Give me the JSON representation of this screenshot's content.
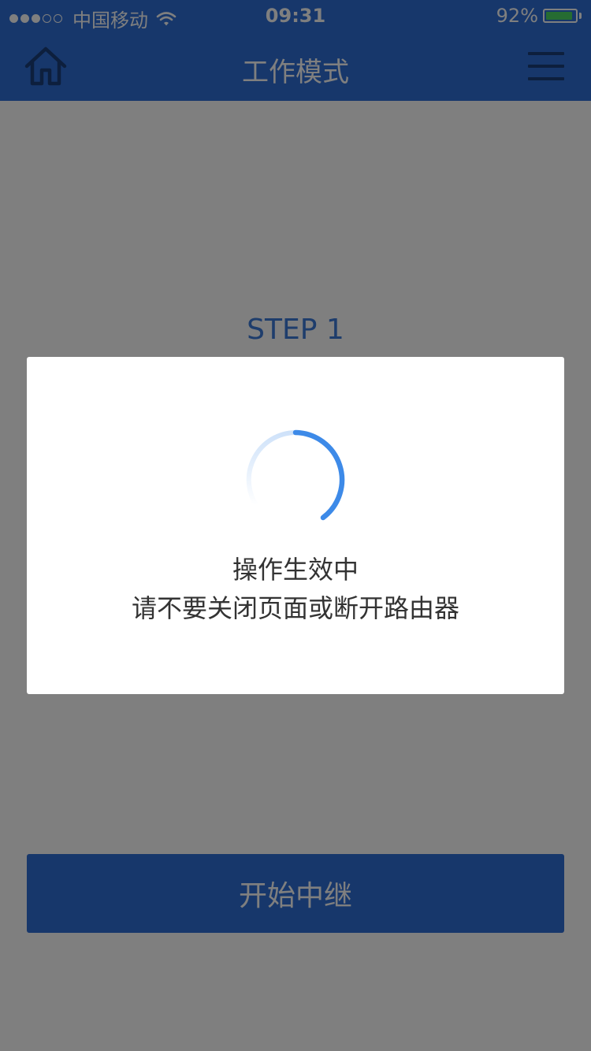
{
  "status_bar": {
    "signal_filled": 3,
    "signal_total": 5,
    "carrier": "中国移动",
    "time": "09:31",
    "battery_percent": "92%",
    "battery_level": 0.92
  },
  "navbar": {
    "title": "工作模式",
    "left_icon": "home-icon",
    "right_icon": "menu-icon"
  },
  "main": {
    "step_label": "STEP 1",
    "start_button_label": "开始中继"
  },
  "dialog": {
    "line1": "操作生效中",
    "line2": "请不要关闭页面或断开路由器",
    "icon": "loading-spinner-icon"
  },
  "colors": {
    "primary": "#2f6fd6",
    "spinner": "#3d8ae8",
    "overlay": "rgba(0,0,0,0.5)"
  }
}
